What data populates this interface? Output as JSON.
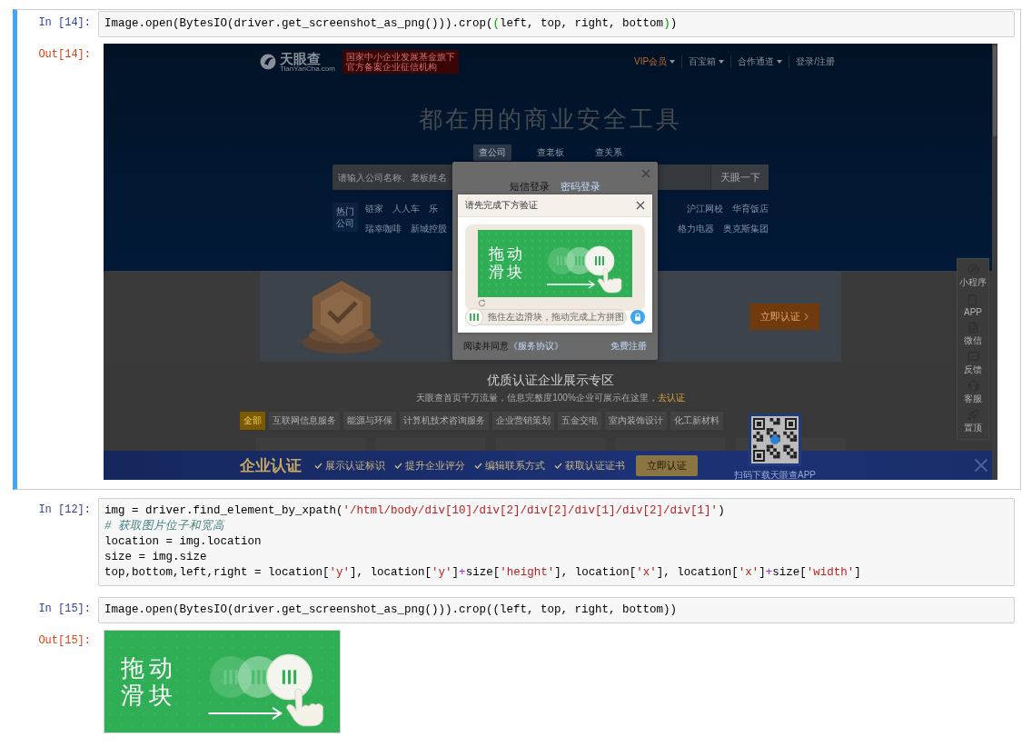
{
  "cells": [
    {
      "kind": "screenshot",
      "selected": true,
      "in_prompt": "In [14]:",
      "out_prompt": "Out[14]:",
      "code": [
        [
          {
            "kind": "plain",
            "text": "Image.open(BytesIO(driver.get_screenshot_as_png())).crop("
          },
          {
            "kind": "bracket",
            "text": "("
          },
          {
            "kind": "plain",
            "text": "left, top, right, bottom"
          },
          {
            "kind": "bracket",
            "text": ")"
          },
          {
            "kind": "plain",
            "text": ")"
          }
        ]
      ]
    },
    {
      "kind": "code",
      "selected": false,
      "in_prompt": "In [12]:",
      "code": [
        [
          {
            "kind": "plain",
            "text": "img = driver.find_element_by_xpath("
          },
          {
            "kind": "string",
            "text": "'/html/body/div[10]/div[2]/div[2]/div[1]/div[2]/div[1]'"
          },
          {
            "kind": "plain",
            "text": ")"
          }
        ],
        [
          {
            "kind": "comment",
            "text": "# 获取图片位子和宽高"
          }
        ],
        [
          {
            "kind": "plain",
            "text": "location = img.location"
          }
        ],
        [
          {
            "kind": "plain",
            "text": "size = img.size"
          }
        ],
        [
          {
            "kind": "plain",
            "text": "top,bottom,left,right = location["
          },
          {
            "kind": "string",
            "text": "'y'"
          },
          {
            "kind": "plain",
            "text": "], location["
          },
          {
            "kind": "string",
            "text": "'y'"
          },
          {
            "kind": "plain",
            "text": "]"
          },
          {
            "kind": "operator",
            "text": "+"
          },
          {
            "kind": "plain",
            "text": "size["
          },
          {
            "kind": "string",
            "text": "'height'"
          },
          {
            "kind": "plain",
            "text": "], location["
          },
          {
            "kind": "string",
            "text": "'x'"
          },
          {
            "kind": "plain",
            "text": "], location["
          },
          {
            "kind": "string",
            "text": "'x'"
          },
          {
            "kind": "plain",
            "text": "]"
          },
          {
            "kind": "operator",
            "text": "+"
          },
          {
            "kind": "plain",
            "text": "size["
          },
          {
            "kind": "string",
            "text": "'width'"
          },
          {
            "kind": "plain",
            "text": "]"
          }
        ]
      ]
    },
    {
      "kind": "crop",
      "selected": false,
      "in_prompt": "In [15]:",
      "out_prompt": "Out[15]:",
      "code": [
        [
          {
            "kind": "plain",
            "text": "Image.open(BytesIO(driver.get_screenshot_as_png())).crop((left, top, right, bottom))"
          }
        ]
      ]
    }
  ],
  "screenshot": {
    "logo": {
      "name": "天眼查",
      "domain": "TianYanCha.com"
    },
    "badge_lines": [
      "国家中小企业发展基金旗下",
      "官方备案企业征信机构"
    ],
    "nav": [
      {
        "label": "VIP会员",
        "dropdown": true,
        "highlight": true
      },
      {
        "label": "百宝箱",
        "dropdown": true,
        "highlight": false
      },
      {
        "label": "合作通道",
        "dropdown": true,
        "highlight": false
      },
      {
        "label": "登录/注册",
        "dropdown": false,
        "highlight": false
      }
    ],
    "headline": "都在用的商业安全工具",
    "search_tabs": [
      {
        "label": "查公司",
        "selected": true
      },
      {
        "label": "查老板",
        "selected": false
      },
      {
        "label": "查关系",
        "selected": false
      }
    ],
    "search": {
      "placeholder": "请输入公司名称、老板姓名",
      "button": "天眼一下"
    },
    "hot": {
      "label_lines": [
        "热门",
        "公司"
      ],
      "left_rows": [
        [
          "链家",
          "人人车",
          "乐"
        ],
        [
          "瑞幸咖啡",
          "新城控股"
        ]
      ],
      "right_rows": [
        [
          "沪江网校",
          "华育饭店"
        ],
        [
          "格力电器",
          "奥克斯集团"
        ]
      ]
    },
    "promo": {
      "button": "立即认证"
    },
    "showcase": {
      "title": "优质认证企业展示专区",
      "subtitle": "天眼查首页千万流量，信息完整度100%企业可展示在这里，",
      "link": "去认证",
      "filters": [
        {
          "label": "全部",
          "selected": true
        },
        {
          "label": "互联网信息服务",
          "selected": false
        },
        {
          "label": "能源与环保",
          "selected": false
        },
        {
          "label": "计算机技术咨询服务",
          "selected": false
        },
        {
          "label": "企业营销策划",
          "selected": false
        },
        {
          "label": "五金交电",
          "selected": false
        },
        {
          "label": "室内装饰设计",
          "selected": false
        },
        {
          "label": "化工新材料",
          "selected": false
        }
      ]
    },
    "sidebar": [
      {
        "kind": "miniprogram",
        "label": "小程序"
      },
      {
        "kind": "app",
        "label": "APP"
      },
      {
        "kind": "wechat",
        "label": "微信"
      },
      {
        "kind": "feedback",
        "label": "反馈"
      },
      {
        "kind": "service",
        "label": "客服"
      },
      {
        "kind": "top",
        "label": "置顶"
      }
    ],
    "login_modal": {
      "tabs": [
        {
          "label": "短信登录",
          "selected": true
        },
        {
          "label": "密码登录",
          "selected": false
        }
      ],
      "agreement": "阅读并同意",
      "agreement_link": "《服务协议》",
      "register": "免费注册"
    },
    "verify_modal": {
      "title": "请先完成下方验证",
      "caption_lines": [
        "拖动",
        "滑块"
      ],
      "slider_hint": "拖住左边滑块，拖动完成上方拼图"
    },
    "cert_bar": {
      "title": "企业认证",
      "perks": [
        "展示认证标识",
        "提升企业评分",
        "编辑联系方式",
        "获取认证证书"
      ],
      "button": "立即认证",
      "qr_caption": "扫码下载天眼查APP"
    }
  },
  "crop_output": {
    "caption_lines": [
      "拖动",
      "滑块"
    ]
  }
}
